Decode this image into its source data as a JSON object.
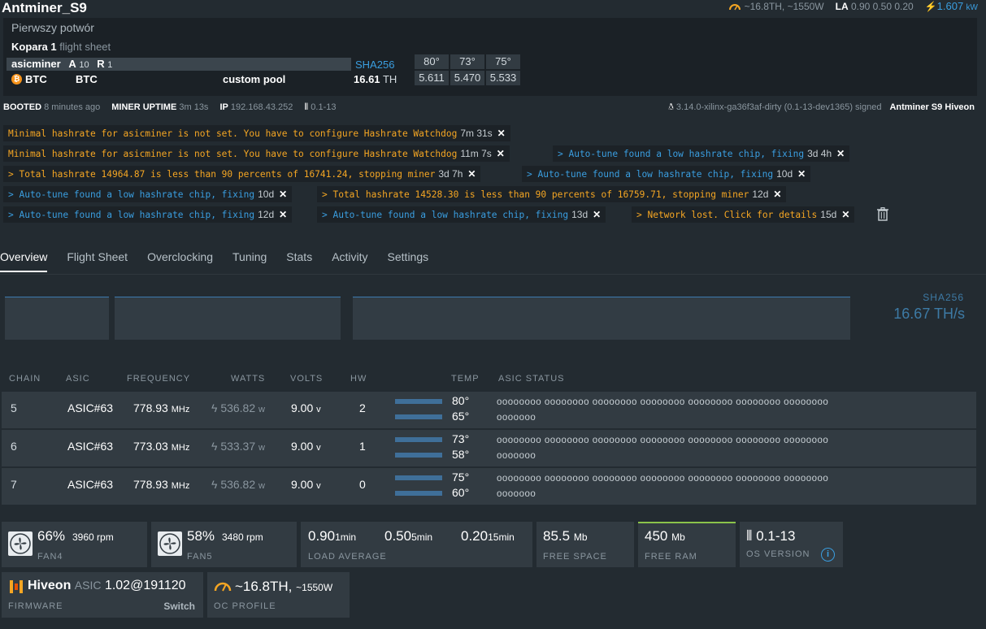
{
  "title": "Antminer_S9",
  "topbar": {
    "hashrate": "~16.8TH, ~1550W",
    "la_label": "LA",
    "la_values": "0.90 0.50 0.20",
    "power": "1.607",
    "power_unit": "kW"
  },
  "header": {
    "worker_desc": "Pierwszy potwór",
    "flight_sheet_name": "Kopara 1",
    "flight_sheet_label": "flight sheet",
    "miner": "asicminer",
    "a_label": "A",
    "a_value": "10",
    "r_label": "R",
    "r_value": "1",
    "coin": "BTC",
    "wallet": "BTC",
    "pool": "custom pool",
    "algo": "SHA256",
    "hashrate": "16.61",
    "hashrate_unit": "TH",
    "chains": [
      {
        "temp": "80°",
        "rate": "5.611"
      },
      {
        "temp": "73°",
        "rate": "5.470"
      },
      {
        "temp": "75°",
        "rate": "5.533"
      }
    ]
  },
  "status": {
    "booted_label": "BOOTED",
    "booted": "8 minutes ago",
    "uptime_label": "MINER UPTIME",
    "uptime": "3m 13s",
    "ip_label": "IP",
    "ip": "192.168.43.252",
    "os_short": "0.1-13",
    "kernel": "3.14.0-xilinx-ga36f3af-dirty (0.1-13-dev1365) signed",
    "model": "Antminer S9 Hiveon"
  },
  "messages": [
    {
      "text": "Minimal hashrate for asicminer is not set. You have to configure Hashrate Watchdog",
      "age": "7m 31s",
      "kind": "warn"
    },
    {
      "text": "Minimal hashrate for asicminer is not set. You have to configure Hashrate Watchdog",
      "age": "11m 7s",
      "kind": "warn"
    },
    {
      "text": "> Auto-tune found a low hashrate chip, fixing",
      "age": "3d 4h",
      "kind": "info"
    },
    {
      "text": "> Total hashrate 14964.87 is less than 90 percents of 16741.24, stopping miner",
      "age": "3d 7h",
      "kind": "warn"
    },
    {
      "text": "> Auto-tune found a low hashrate chip, fixing",
      "age": "10d",
      "kind": "info"
    },
    {
      "text": "> Auto-tune found a low hashrate chip, fixing",
      "age": "10d",
      "kind": "info"
    },
    {
      "text": "> Total hashrate 14528.30 is less than 90 percents of 16759.71, stopping miner",
      "age": "12d",
      "kind": "warn"
    },
    {
      "text": "> Auto-tune found a low hashrate chip, fixing",
      "age": "12d",
      "kind": "info"
    },
    {
      "text": "> Auto-tune found a low hashrate chip, fixing",
      "age": "13d",
      "kind": "info"
    },
    {
      "text": "> Network lost. Click for details",
      "age": "15d",
      "kind": "warn"
    }
  ],
  "tabs": [
    "Overview",
    "Flight Sheet",
    "Overclocking",
    "Tuning",
    "Stats",
    "Activity",
    "Settings"
  ],
  "graph": {
    "algo": "SHA256",
    "hashrate": "16.67 TH/s"
  },
  "table": {
    "headers": [
      "CHAIN",
      "ASIC",
      "FREQUENCY",
      "WATTS",
      "VOLTS",
      "HW",
      "TEMP",
      "ASIC STATUS"
    ],
    "freq_unit": "MHz",
    "watt_unit": "w",
    "volt_unit": "v",
    "rows": [
      {
        "chain": "5",
        "asic": "ASIC#63",
        "freq": "778.93",
        "watts": "536.82",
        "volts": "9.00",
        "hw": "2",
        "temp1": "80°",
        "temp2": "65°",
        "status1": "oooooooo oooooooo oooooooo oooooooo oooooooo oooooooo oooooooo",
        "status2": "ooooooo"
      },
      {
        "chain": "6",
        "asic": "ASIC#63",
        "freq": "773.03",
        "watts": "533.37",
        "volts": "9.00",
        "hw": "1",
        "temp1": "73°",
        "temp2": "58°",
        "status1": "oooooooo oooooooo oooooooo oooooooo oooooooo oooooooo oooooooo",
        "status2": "ooooooo"
      },
      {
        "chain": "7",
        "asic": "ASIC#63",
        "freq": "778.93",
        "watts": "536.82",
        "volts": "9.00",
        "hw": "0",
        "temp1": "75°",
        "temp2": "60°",
        "status1": "oooooooo oooooooo oooooooo oooooooo oooooooo oooooooo oooooooo",
        "status2": "ooooooo"
      }
    ]
  },
  "cards": {
    "fan4": {
      "pct": "66%",
      "rpm": "3960 rpm",
      "label": "FAN4"
    },
    "fan5": {
      "pct": "58%",
      "rpm": "3480 rpm",
      "label": "FAN5"
    },
    "load": {
      "v1": "0.90",
      "u1": "1min",
      "v2": "0.50",
      "u2": "5min",
      "v3": "0.20",
      "u3": "15min",
      "label": "LOAD AVERAGE"
    },
    "space": {
      "value": "85.5",
      "unit": "Mb",
      "label": "FREE SPACE"
    },
    "ram": {
      "value": "450",
      "unit": "Mb",
      "label": "FREE RAM"
    },
    "os": {
      "value": "0.1-13",
      "label": "OS VERSION"
    },
    "firmware": {
      "brand": "Hiveon",
      "kind": "ASIC",
      "version": "1.02@191120",
      "label": "FIRMWARE",
      "action": "Switch"
    },
    "oc": {
      "value": "~16.8TH,",
      "watts": "~1550W",
      "label": "OC PROFILE"
    }
  },
  "colors": {
    "bg": "#232b31",
    "panel": "#323b42",
    "warn": "#f5a623",
    "info": "#3a9ee0",
    "bar": "#3f6f99"
  }
}
